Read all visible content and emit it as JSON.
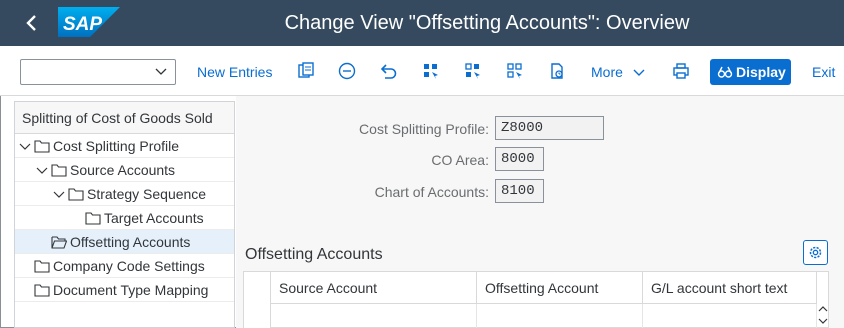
{
  "titlebar": {
    "logo_text": "SAP",
    "title": "Change View \"Offsetting Accounts\": Overview"
  },
  "toolbar": {
    "select_value": "",
    "new_entries": "New Entries",
    "more": "More",
    "display": "Display",
    "exit": "Exit",
    "icons": [
      "copy-icon",
      "delete-icon",
      "undo-icon",
      "select-all-icon",
      "select-block-icon",
      "deselect-all-icon",
      "transport-icon",
      "print-icon"
    ]
  },
  "tree": {
    "header": "Splitting of Cost of Goods Sold",
    "items": [
      {
        "label": "Cost Splitting Profile",
        "level": 0,
        "expanded": true
      },
      {
        "label": "Source Accounts",
        "level": 1,
        "expanded": true
      },
      {
        "label": "Strategy Sequence",
        "level": 2,
        "expanded": true
      },
      {
        "label": "Target Accounts",
        "level": 3,
        "expanded": false
      },
      {
        "label": "Offsetting Accounts",
        "level": 1,
        "expanded": false,
        "selected": true
      },
      {
        "label": "Company Code Settings",
        "level": 0,
        "expanded": false
      },
      {
        "label": "Document Type Mapping",
        "level": 0,
        "expanded": false
      }
    ]
  },
  "form": {
    "cost_splitting_profile_label": "Cost Splitting Profile:",
    "cost_splitting_profile_value": "Z8000",
    "co_area_label": "CO Area:",
    "co_area_value": "8000",
    "chart_of_accounts_label": "Chart of Accounts:",
    "chart_of_accounts_value": "8100"
  },
  "table": {
    "title": "Offsetting Accounts",
    "columns": [
      "Source Account",
      "Offsetting Account",
      "G/L account short text"
    ]
  },
  "colors": {
    "shell": "#354a5f",
    "accent": "#0a6ed1",
    "selected_row": "#e5f0fa"
  }
}
